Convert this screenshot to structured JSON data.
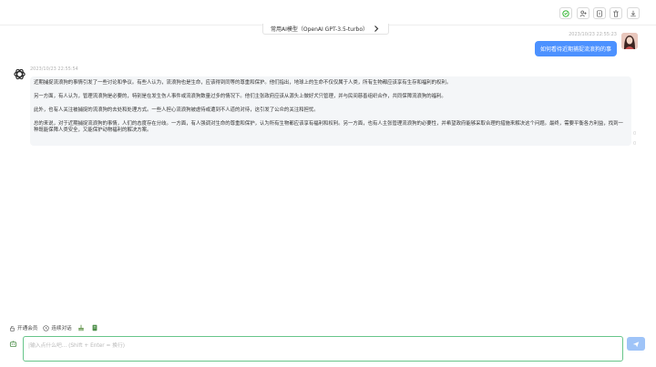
{
  "toolbar": {
    "icons": [
      "wechat-icon",
      "add-user-icon",
      "copy-icon",
      "delete-icon",
      "download-icon"
    ]
  },
  "model_selector": {
    "label": "常用AI模型（OpenAI GPT-3.5-turbo）"
  },
  "messages": {
    "user": {
      "time": "2023/10/23 22:55:23",
      "text": "如何看待近期捕捉流浪狗的事"
    },
    "assistant": {
      "time": "2023/10/23 22:55:54",
      "paragraphs": [
        "近期捕捉流浪狗的事情引发了一些讨论和争议。有些人认为，流浪狗也是生命，应该得到同等的尊重和保护。他们指出，地球上的生命不仅仅属于人类，所有生物都应该享有生存和福利的权利。",
        "另一方面，有人认为，管理流浪狗是必要的，特别是在发生伤人事件或流浪狗数量过多的情况下。他们主张政府应该从源头上做好犬只管理，并与民间慈善组织合作，共同保障流浪狗的福利。",
        "此外，也有人关注被捕捉的流浪狗的去处和处理方式。一些人担心流浪狗被虐待或遭到不人道的对待，这引发了公众的关注和担忧。",
        "总的来说，对于近期捕捉流浪狗的事情，人们的态度存在分歧。一方面，有人强调对生命的尊重和保护，认为所有生物都应该享有福利和权利。另一方面，也有人主张管理流浪狗的必要性，并希望政府能够采取合理的措施来解决这个问题。最终，需要平衡各方利益，找到一种既能保障人类安全，又能保护动物福利的解决方案。"
      ]
    }
  },
  "side_marks": [
    "0",
    "0"
  ],
  "actions": {
    "vip_label": "开通会员",
    "continuous_label": "连续对话"
  },
  "input": {
    "placeholder": "|输入点什么吧... (Shift + Enter = 换行)"
  },
  "colors": {
    "accent": "#4c91ff",
    "input_border": "#67c58a",
    "send_button": "#9fc4f8",
    "bubble_bg": "#f4f6f8"
  }
}
